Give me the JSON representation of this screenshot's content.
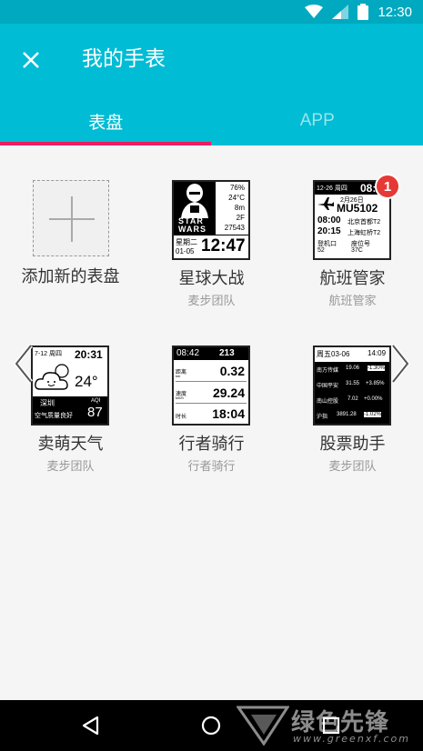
{
  "status_bar": {
    "time": "12:30",
    "wifi_icon": "wifi-icon",
    "signal_icon": "signal-icon",
    "battery_icon": "battery-icon"
  },
  "app_bar": {
    "title": "我的手表",
    "close_icon": "close-icon"
  },
  "tabs": [
    {
      "label": "表盘",
      "active": true
    },
    {
      "label": "APP",
      "active": false
    }
  ],
  "colors": {
    "primary": "#00bcd4",
    "status": "#00a9bf",
    "accent": "#e91e63",
    "badge": "#e53935"
  },
  "add_watchface": {
    "label": "添加新的表盘"
  },
  "watchfaces": [
    {
      "name": "星球大战",
      "author": "麦步团队",
      "preview": {
        "stats": [
          "76%",
          "24°C",
          "8m",
          "2F",
          "27543"
        ],
        "logo_top": "STAR",
        "logo_bottom": "WARS",
        "weekday": "星期二",
        "date": "01-05",
        "time": "12:47"
      }
    },
    {
      "name": "航班管家",
      "author": "航班管家",
      "badge": "1",
      "preview": {
        "date": "12-26 周四",
        "time": "08:2",
        "flight_date": "2月26日",
        "flight_no": "MU5102",
        "dep_time": "08:00",
        "dep_airport": "北京首都T2",
        "arr_time": "20:15",
        "arr_airport": "上海虹桥T2",
        "gate_label": "登机口",
        "seat_label": "座位号",
        "gate": "52",
        "seat": "37C"
      }
    },
    {
      "name": "卖萌天气",
      "author": "麦步团队",
      "preview": {
        "date": "7-12 周四",
        "time": "20:31",
        "temp": "24°",
        "city": "深圳",
        "aqi_label": "AQI",
        "aqi_text": "空气质量良好",
        "aqi": "87"
      }
    },
    {
      "name": "行者骑行",
      "author": "行者骑行",
      "preview": {
        "time": "08:42",
        "altitude": "213",
        "rows": [
          {
            "label": "距离",
            "unit": "km",
            "value": "0.32"
          },
          {
            "label": "速度",
            "unit": "km/h",
            "value": "29.24"
          },
          {
            "label": "时长",
            "unit": "",
            "value": "18:04"
          }
        ]
      }
    },
    {
      "name": "股票助手",
      "author": "麦步团队",
      "preview": {
        "date": "周五03-06",
        "time": "14:09",
        "rows": [
          {
            "name": "南方传媒",
            "value": "19.06",
            "change": "-1.30%"
          },
          {
            "name": "中国平安",
            "value": "31.55",
            "change": "+3.85%"
          },
          {
            "name": "南山控股",
            "value": "7.02",
            "change": "+0.00%"
          },
          {
            "name": "沪指",
            "value": "3891.28",
            "change": "-1.02%"
          }
        ]
      }
    }
  ],
  "nav_bar": {
    "back_icon": "back-icon",
    "home_icon": "home-icon",
    "recents_icon": "recents-icon"
  },
  "watermark": {
    "text": "绿色先锋",
    "url": "www.greenxf.com"
  }
}
